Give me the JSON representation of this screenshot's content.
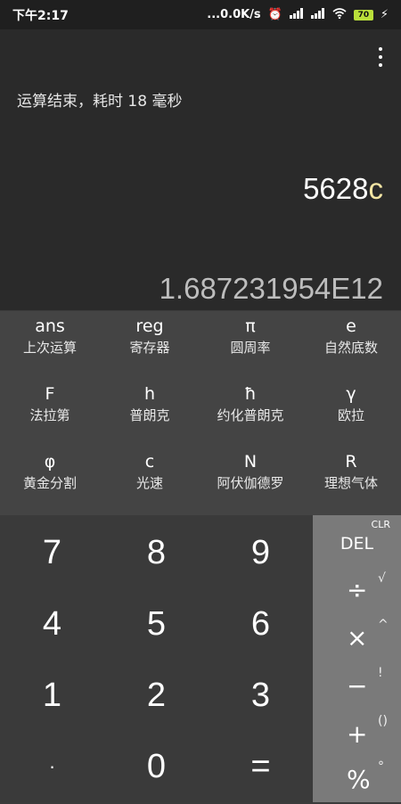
{
  "status": {
    "time": "下午2:17",
    "speed": "...0.0K/s",
    "battery": "70"
  },
  "display": {
    "info": "运算结束，耗时 18 毫秒",
    "expr_number": "5628",
    "expr_const": "c",
    "result": "1.687231954E12"
  },
  "constants": [
    {
      "sym": "ans",
      "name": "上次运算"
    },
    {
      "sym": "reg",
      "name": "寄存器"
    },
    {
      "sym": "π",
      "name": "圆周率"
    },
    {
      "sym": "e",
      "name": "自然底数"
    },
    {
      "sym": "F",
      "name": "法拉第"
    },
    {
      "sym": "h",
      "name": "普朗克"
    },
    {
      "sym": "ħ",
      "name": "约化普朗克"
    },
    {
      "sym": "γ",
      "name": "欧拉"
    },
    {
      "sym": "φ",
      "name": "黄金分割"
    },
    {
      "sym": "c",
      "name": "光速"
    },
    {
      "sym": "N",
      "name": "阿伏伽德罗"
    },
    {
      "sym": "R",
      "name": "理想气体"
    }
  ],
  "numpad": [
    "7",
    "8",
    "9",
    "4",
    "5",
    "6",
    "1",
    "2",
    "3",
    "·",
    "0",
    "="
  ],
  "ops": {
    "clr": "CLR",
    "del": "DEL",
    "divide": "÷",
    "sqrt": "√",
    "multiply": "×",
    "power": "^",
    "minus": "−",
    "factorial": "!",
    "plus": "+",
    "parens": "()",
    "percent": "%",
    "degree": "°"
  },
  "colors": {
    "display_bg": "#2a2a2a",
    "const_panel_bg": "#444444",
    "numpad_bg": "#3a3a3a",
    "ops_bg": "#7a7a7a",
    "const_highlight": "#f4e6a4",
    "battery": "#b9df3a"
  }
}
